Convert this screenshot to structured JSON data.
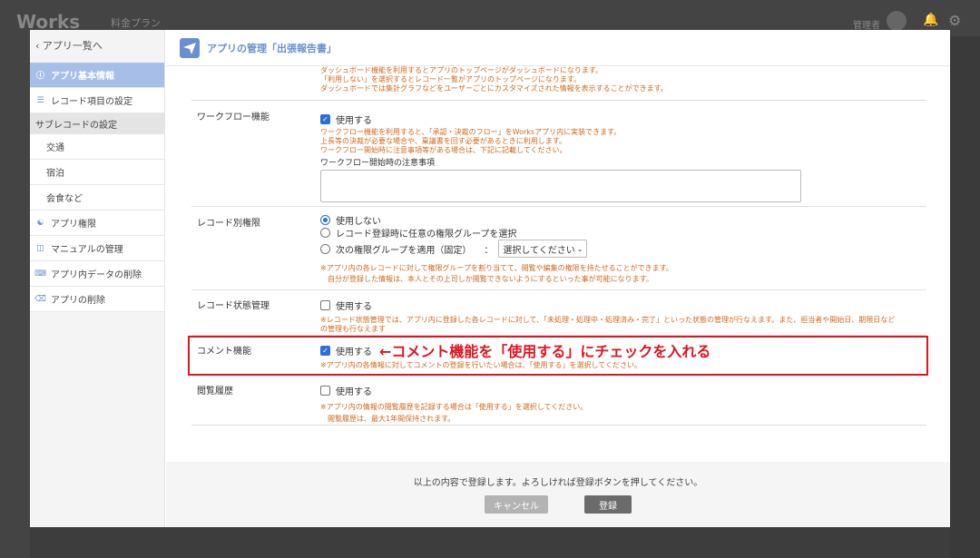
{
  "background": {
    "logo": "Works",
    "plan": "料金プラン",
    "admin": "管理者"
  },
  "sidebar": {
    "back": "アプリ一覧へ",
    "items": [
      {
        "label": "アプリ基本情報",
        "icon": "info-icon"
      },
      {
        "label": "レコード項目の設定",
        "icon": "list-icon"
      },
      {
        "label": "サブレコードの設定",
        "icon": ""
      },
      {
        "label": "交通",
        "icon": ""
      },
      {
        "label": "宿泊",
        "icon": ""
      },
      {
        "label": "会食など",
        "icon": ""
      },
      {
        "label": "アプリ権限",
        "icon": "users-icon"
      },
      {
        "label": "マニュアルの管理",
        "icon": "book-icon"
      },
      {
        "label": "アプリ内データの削除",
        "icon": "eraser-icon"
      },
      {
        "label": "アプリの削除",
        "icon": "trash-icon"
      }
    ]
  },
  "header": {
    "title": "アプリの管理「出張報告書」"
  },
  "dashboard": {
    "notes": [
      "ダッシュボード機能を利用するとアプリのトップページがダッシュボードになります。",
      "「利用しない」を選択するとレコード一覧がアプリのトップページになります。",
      "ダッシュボードでは集計グラフなどをユーザーごとにカスタマイズされた情報を表示することができます。"
    ]
  },
  "workflow": {
    "label": "ワークフロー機能",
    "check": "使用する",
    "notes": [
      "ワークフロー機能を利用すると、「承認・決裁のフロー」をWorksアプリ内に実装できます。",
      "上長等の決裁が必要な場合や、稟議書を回す必要があるときに利用します。",
      "ワークフロー開始時に注意事項等がある場合は、下記に記載してください。"
    ],
    "sublabel": "ワークフロー開始時の注意事項"
  },
  "record_permission": {
    "label": "レコード別権限",
    "options": [
      "使用しない",
      "レコード登録時に任意の権限グループを選択",
      "次の権限グループを適用（固定）"
    ],
    "colon": "：",
    "select": "選択してください",
    "notes": [
      "※アプリ内の各レコードに対して権限グループを割り当てて、閲覧や編集の権限を持たせることができます。",
      "自分が登録した情報は、本人とその上司しか閲覧できないようにするといった事が可能になります。"
    ]
  },
  "record_status": {
    "label": "レコード状態管理",
    "check": "使用する",
    "notes": [
      "※レコード状態管理では、アプリ内に登録した各レコードに対して、「未処理・処理中・処理済み・完了」といった状態の管理が行なえます。また、担当者や開始日、期限日など",
      "の管理も行なえます"
    ]
  },
  "comment": {
    "label": "コメント機能",
    "check": "使用する",
    "annotation": "←コメント機能を「使用する」にチェックを入れる",
    "note": "※アプリ内の各情報に対してコメントの登録を行いたい場合は、「使用する」を選択してください。"
  },
  "history": {
    "label": "閲覧履歴",
    "check": "使用する",
    "notes": [
      "※アプリ内の情報の閲覧履歴を記録する場合は「使用する」を選択してください。",
      "閲覧履歴は、最大1年間保持されます。"
    ]
  },
  "footer": {
    "message": "以上の内容で登録します。よろしければ登録ボタンを押してください。",
    "cancel": "キャンセル",
    "save": "登録"
  },
  "colors": {
    "accent": "#6a8fd1",
    "active_sidebar": "#a7bfe8",
    "note": "#d2691e",
    "highlight": "#e0141e"
  }
}
